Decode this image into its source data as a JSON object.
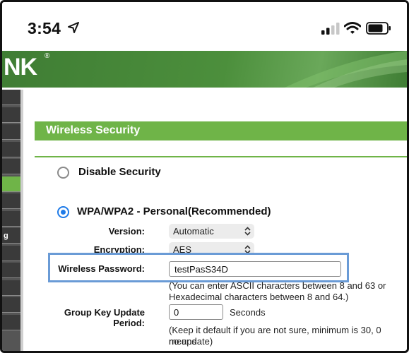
{
  "status_bar": {
    "time": "3:54",
    "icons": [
      "location-arrow-icon",
      "cellular-signal-icon",
      "wifi-icon",
      "battery-icon"
    ]
  },
  "header": {
    "logo_text": "NK",
    "logo_mark": "®",
    "banner_color": "#4c8f3c"
  },
  "sidebar": {
    "items": [
      {
        "label": ""
      },
      {
        "label": ""
      },
      {
        "label": ""
      },
      {
        "label": ""
      },
      {
        "label": ""
      },
      {
        "label": ""
      },
      {
        "label": ""
      },
      {
        "label": ""
      },
      {
        "label": "g"
      },
      {
        "label": ""
      },
      {
        "label": ""
      },
      {
        "label": ""
      },
      {
        "label": ""
      },
      {
        "label": ""
      }
    ],
    "active_index": 5,
    "active_color": "#6fb448"
  },
  "main": {
    "section_title": "Wireless Security",
    "accent_color": "#6fb448",
    "option_disable": "Disable Security",
    "option_wpa": "WPA/WPA2 - Personal(Recommended)",
    "selected_option": "WPA/WPA2 - Personal(Recommended)",
    "version": {
      "label": "Version:",
      "value": "Automatic"
    },
    "encryption": {
      "label": "Encryption:",
      "value": "AES"
    },
    "password": {
      "label": "Wireless Password:",
      "value": "testPasS34D"
    },
    "password_hint_1": "(You can enter ASCII characters between 8 and 63 or",
    "password_hint_2": "Hexadecimal characters between 8 and 64.)",
    "group_key": {
      "label": "Group Key Update Period:",
      "value": "0",
      "unit": "Seconds"
    },
    "group_key_hint_1": "(Keep it default if you are not sure, minimum is 30, 0 means",
    "group_key_hint_2": "no update)"
  }
}
